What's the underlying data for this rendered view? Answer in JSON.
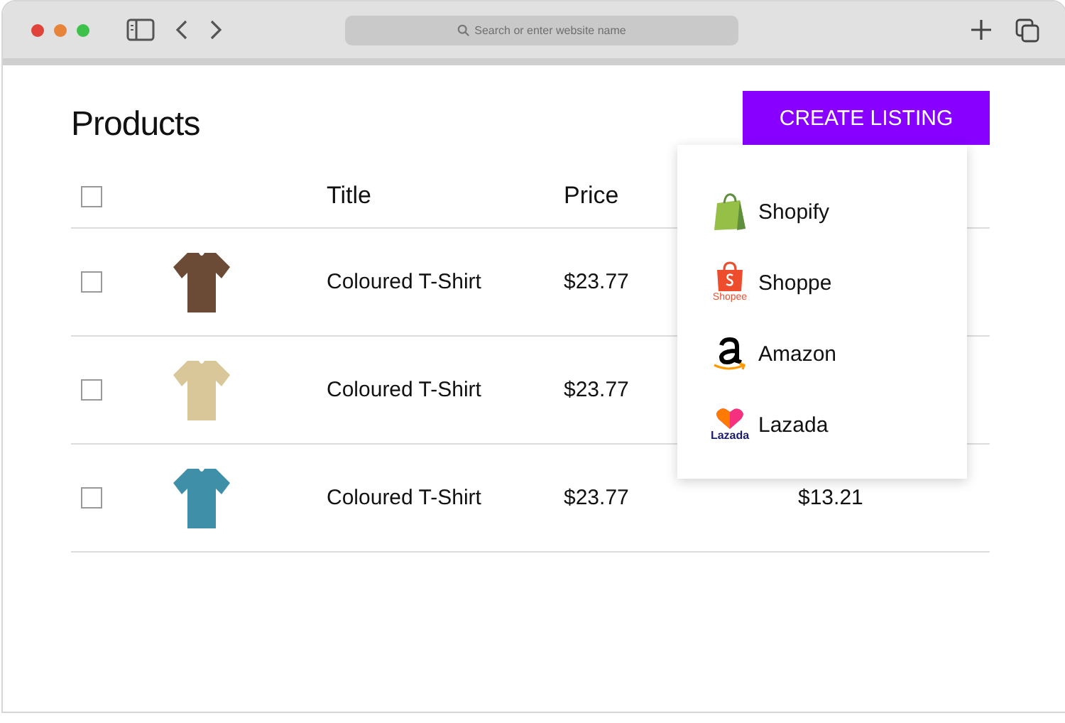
{
  "browser": {
    "address_placeholder": "Search or enter website name"
  },
  "page": {
    "title": "Products",
    "create_button": "CREATE LISTING"
  },
  "table": {
    "header_checkbox": {
      "checked": false
    },
    "columns": [
      "Title",
      "Price"
    ],
    "rows": [
      {
        "checked": false,
        "title": "Coloured T-Shirt",
        "price": "$23.77"
      },
      {
        "checked": false,
        "title": "Coloured T-Shirt",
        "price": "$23.77"
      },
      {
        "checked": false,
        "title": "Coloured T-Shirt",
        "price": "$23.77",
        "column_4": "$13.21"
      }
    ]
  },
  "dropdown": {
    "items": [
      {
        "kind": "shopify",
        "label": "Shopify"
      },
      {
        "kind": "shopee",
        "label": "Shoppe",
        "logo_text": "Shopee"
      },
      {
        "kind": "amazon",
        "label": "Amazon"
      },
      {
        "kind": "lazada",
        "label": "Lazada",
        "logo_text": "Lazada"
      }
    ]
  }
}
